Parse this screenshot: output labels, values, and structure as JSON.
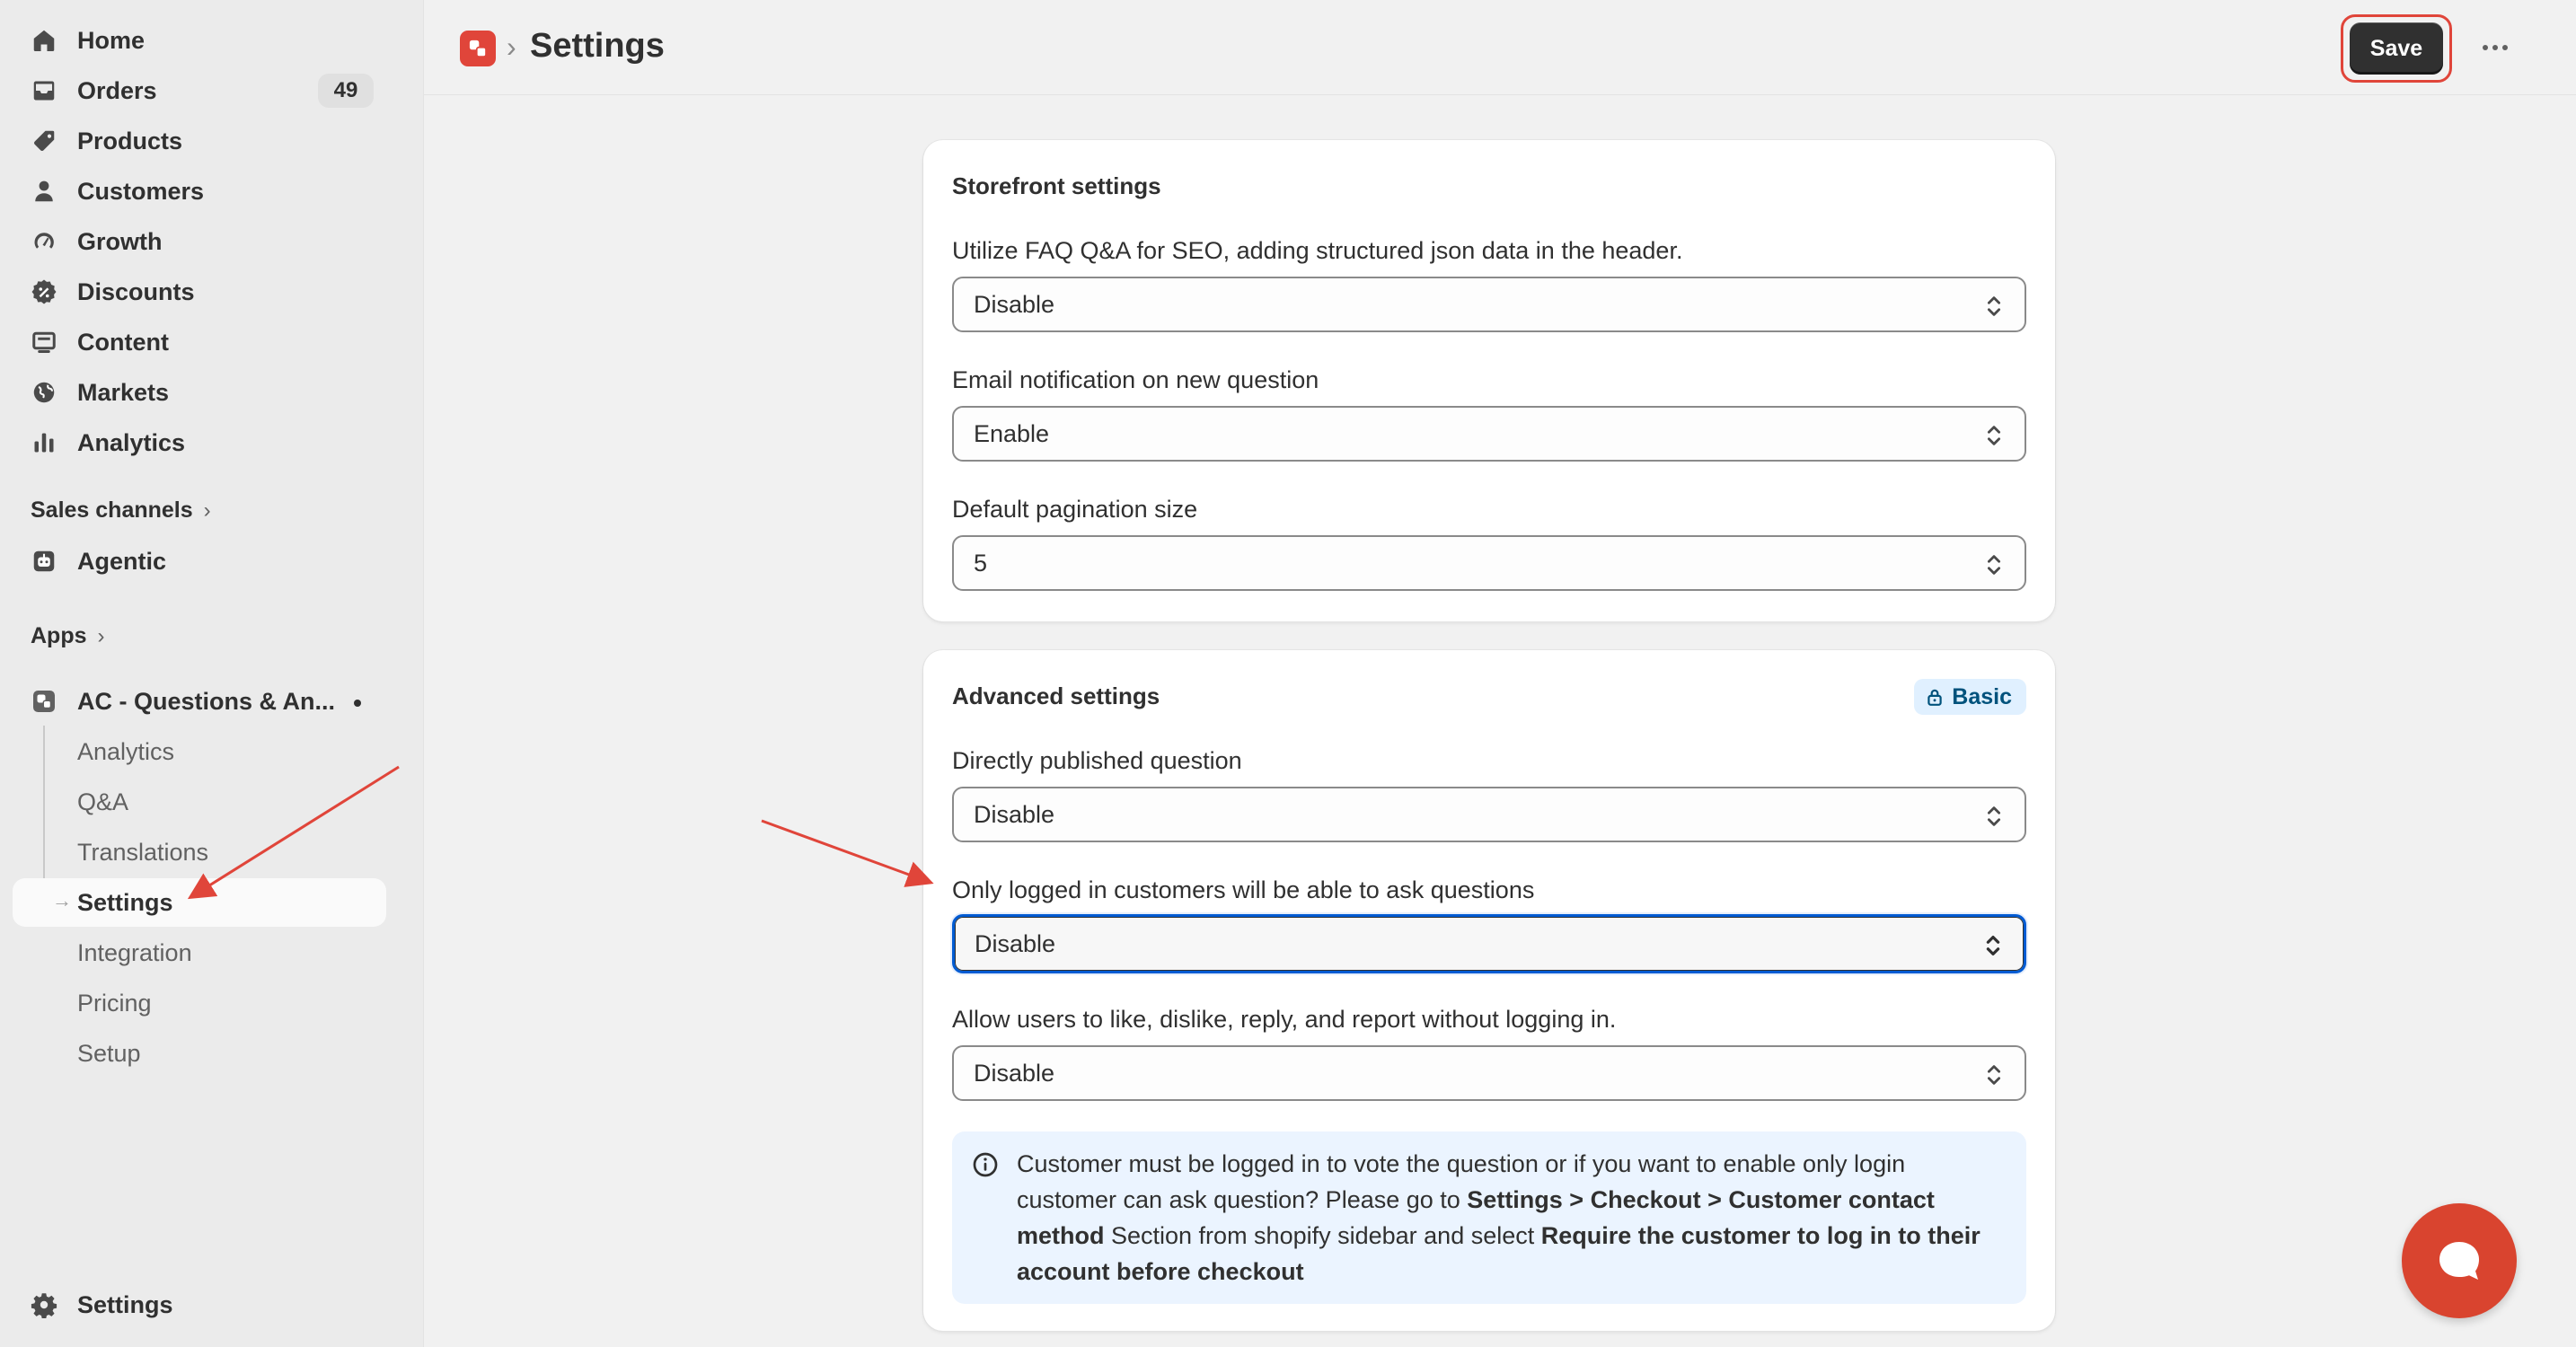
{
  "sidebar": {
    "nav": [
      {
        "label": "Home",
        "icon": "home-icon"
      },
      {
        "label": "Orders",
        "icon": "orders-icon",
        "badge": "49"
      },
      {
        "label": "Products",
        "icon": "tag-icon"
      },
      {
        "label": "Customers",
        "icon": "person-icon"
      },
      {
        "label": "Growth",
        "icon": "gauge-icon"
      },
      {
        "label": "Discounts",
        "icon": "discount-icon"
      },
      {
        "label": "Content",
        "icon": "content-icon"
      },
      {
        "label": "Markets",
        "icon": "globe-icon"
      },
      {
        "label": "Analytics",
        "icon": "bar-chart-icon"
      }
    ],
    "sales_channels_label": "Sales channels",
    "agentic_label": "Agentic",
    "apps_label": "Apps",
    "app_name": "AC - Questions & An...",
    "app_subitems": [
      "Analytics",
      "Q&A",
      "Translations",
      "Settings",
      "Integration",
      "Pricing",
      "Setup"
    ],
    "active_subitem": "Settings",
    "footer_settings_label": "Settings"
  },
  "header": {
    "title": "Settings",
    "save_label": "Save"
  },
  "storefront": {
    "title": "Storefront settings",
    "fields": [
      {
        "label": "Utilize FAQ Q&A for SEO, adding structured json data in the header.",
        "value": "Disable"
      },
      {
        "label": "Email notification on new question",
        "value": "Enable"
      },
      {
        "label": "Default pagination size",
        "value": "5"
      }
    ]
  },
  "advanced": {
    "title": "Advanced settings",
    "plan_badge": "Basic",
    "fields": [
      {
        "label": "Directly published question",
        "value": "Disable"
      },
      {
        "label": "Only logged in customers will be able to ask questions",
        "value": "Disable"
      },
      {
        "label": "Allow users to like, dislike, reply, and report without logging in.",
        "value": "Disable"
      }
    ],
    "info": {
      "t1": "Customer must be logged in to vote the question or if you want to enable only login customer can ask question? Please go to ",
      "b1": "Settings > Checkout > Customer contact method",
      "t2": " Section from shopify sidebar and select ",
      "b2": "Require the customer to log in to their account before checkout"
    }
  },
  "colors": {
    "accent_red": "#e0453a",
    "focus_blue": "#005bd3",
    "info_bg": "#ebf4ff",
    "save_bg": "#303030"
  }
}
